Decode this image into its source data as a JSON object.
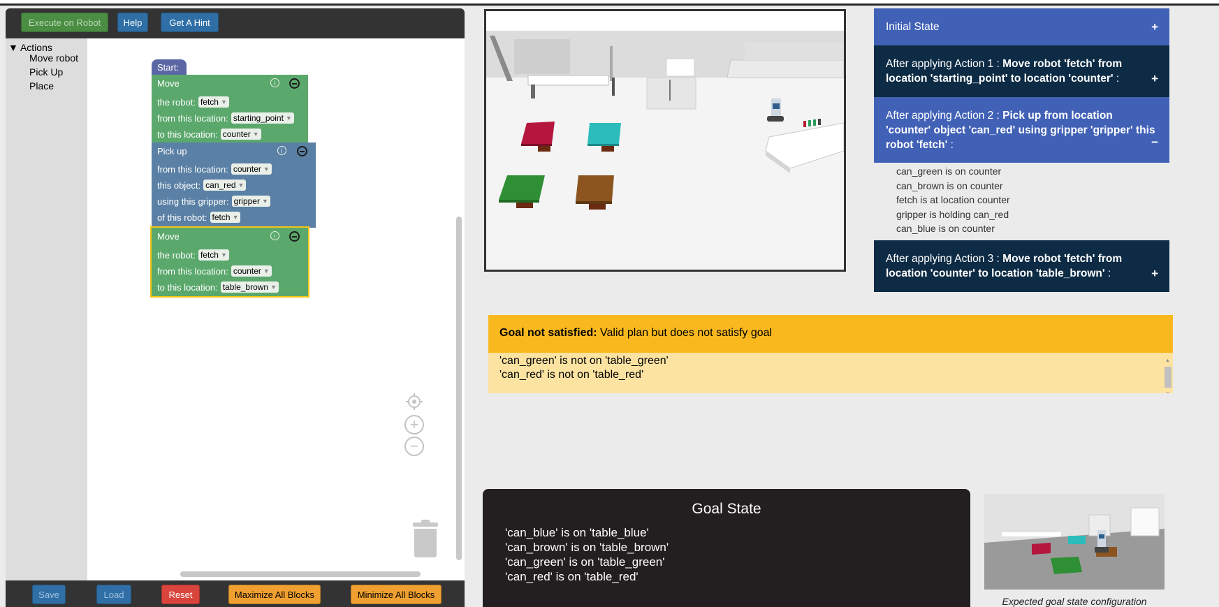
{
  "toolbar": {
    "execute_label": "Execute on Robot",
    "help_label": "Help",
    "hint_label": "Get A Hint"
  },
  "actions_tree": {
    "root_label": "▼ Actions",
    "items": [
      "Move robot",
      "Pick Up",
      "Place"
    ]
  },
  "blocks": {
    "start_label": "Start:",
    "move1": {
      "title": "Move",
      "robot_label": "the robot:",
      "robot_value": "fetch",
      "from_label": "from this location:",
      "from_value": "starting_point",
      "to_label": "to this location:",
      "to_value": "counter"
    },
    "pick": {
      "title": "Pick up",
      "from_label": "from this location:",
      "from_value": "counter",
      "object_label": "this object:",
      "object_value": "can_red",
      "gripper_label": "using this gripper:",
      "gripper_value": "gripper",
      "robot_label": "of this robot:",
      "robot_value": "fetch"
    },
    "move2": {
      "title": "Move",
      "robot_label": "the robot:",
      "robot_value": "fetch",
      "from_label": "from this location:",
      "from_value": "counter",
      "to_label": "to this location:",
      "to_value": "table_brown"
    }
  },
  "bottom_bar": {
    "save_label": "Save",
    "load_label": "Load",
    "reset_label": "Reset",
    "maximize_label": "Maximize All Blocks",
    "minimize_label": "Minimize All Blocks"
  },
  "state_panel": {
    "initial_label": "Initial State",
    "action1_prefix": "After applying Action 1 : ",
    "action1_bold": "Move robot 'fetch' from location 'starting_point' to location 'counter'",
    "action1_suffix": " :",
    "action2_prefix": "After applying Action 2 : ",
    "action2_bold": "Pick up from location 'counter' object 'can_red' using gripper 'gripper' this robot 'fetch'",
    "action2_suffix": " :",
    "action2_facts": [
      "can_green is on counter",
      "can_brown is on counter",
      "fetch is at location counter",
      "gripper is holding can_red",
      "can_blue is on counter"
    ],
    "action3_prefix": "After applying Action 3 : ",
    "action3_bold": "Move robot 'fetch' from location 'counter' to location 'table_brown'",
    "action3_suffix": " :",
    "plus": "+",
    "minus": "−",
    "colors": {
      "initial": "#4161b7",
      "action_collapsed": "#0d2b45",
      "action_expanded": "#4161b7"
    }
  },
  "goal_message": {
    "status_bold": "Goal not satisfied:",
    "status_text": " Valid plan but does not satisfy goal",
    "lines": [
      "'can_green' is not on 'table_green'",
      "'can_red' is not on 'table_red'"
    ]
  },
  "goal_state": {
    "title": "Goal State",
    "lines": [
      "'can_blue' is on 'table_blue'",
      "'can_brown' is on 'table_brown'",
      "'can_green' is on 'table_green'",
      "'can_red' is on 'table_red'"
    ],
    "caption": "Expected goal state configuration"
  }
}
